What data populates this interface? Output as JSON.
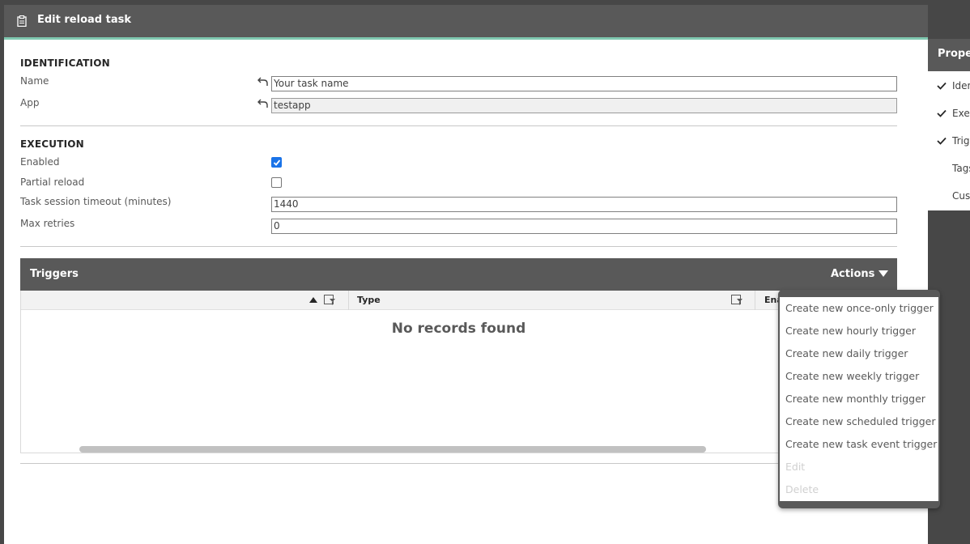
{
  "header": {
    "title": "Edit reload task",
    "icon": "clipboard-icon"
  },
  "identification": {
    "title": "IDENTIFICATION",
    "name_label": "Name",
    "name_value": "Your task name",
    "app_label": "App",
    "app_value": "testapp"
  },
  "execution": {
    "title": "EXECUTION",
    "enabled_label": "Enabled",
    "enabled": true,
    "partial_label": "Partial reload",
    "partial": false,
    "timeout_label": "Task session timeout (minutes)",
    "timeout_value": "1440",
    "retries_label": "Max retries",
    "retries_value": "0"
  },
  "triggers": {
    "title": "Triggers",
    "actions_label": "Actions",
    "columns": {
      "type": "Type",
      "enabled": "Ena"
    },
    "empty_text": "No records found"
  },
  "actions_menu": {
    "items": [
      {
        "label": "Create new once-only trigger",
        "disabled": false
      },
      {
        "label": "Create new hourly trigger",
        "disabled": false
      },
      {
        "label": "Create new daily trigger",
        "disabled": false
      },
      {
        "label": "Create new weekly trigger",
        "disabled": false
      },
      {
        "label": "Create new monthly trigger",
        "disabled": false
      },
      {
        "label": "Create new scheduled trigger",
        "disabled": false
      },
      {
        "label": "Create new task event trigger",
        "disabled": false
      },
      {
        "label": "Edit",
        "disabled": true
      },
      {
        "label": "Delete",
        "disabled": true
      }
    ]
  },
  "properties": {
    "title": "Proper",
    "items": [
      {
        "label": "Iden",
        "checked": true
      },
      {
        "label": "Exec",
        "checked": true
      },
      {
        "label": "Trig",
        "checked": true
      },
      {
        "label": "Tags",
        "checked": false
      },
      {
        "label": "Cus",
        "checked": false
      }
    ]
  },
  "colors": {
    "header_bg": "#595959",
    "accent": "#7fc8b0",
    "checkbox_checked": "#1a73e8",
    "disabled_text": "#d0d0d0"
  }
}
